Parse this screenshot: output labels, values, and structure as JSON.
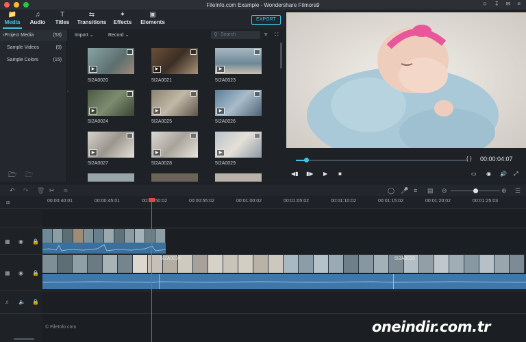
{
  "window": {
    "title": "FileInfo.com Example - Wondershare Filmora9",
    "traffic_colors": [
      "#ff5f57",
      "#febc2e",
      "#28c840"
    ],
    "titlebar_icons": [
      "user-icon",
      "download-icon",
      "mail-icon",
      "menu-icon"
    ]
  },
  "tabs": [
    {
      "label": "Media",
      "icon": "folder-icon",
      "active": true
    },
    {
      "label": "Audio",
      "icon": "music-note-icon",
      "active": false
    },
    {
      "label": "Titles",
      "icon": "text-icon",
      "active": false
    },
    {
      "label": "Transitions",
      "icon": "transitions-icon",
      "active": false
    },
    {
      "label": "Effects",
      "icon": "effects-icon",
      "active": false
    },
    {
      "label": "Elements",
      "icon": "elements-icon",
      "active": false
    }
  ],
  "export_label": "EXPORT",
  "accent_color": "#3fc5e6",
  "sidebar": {
    "items": [
      {
        "label": "Project Media",
        "count": "(53)",
        "prefix": "›"
      },
      {
        "label": "Sample Videos",
        "count": "(9)",
        "prefix": ""
      },
      {
        "label": "Sample Colors",
        "count": "(15)",
        "prefix": ""
      }
    ]
  },
  "media_toolbar": {
    "import_label": "Import",
    "record_label": "Record",
    "search_placeholder": "Search"
  },
  "media_items": [
    {
      "name": "5I2A0020"
    },
    {
      "name": "5I2A0021"
    },
    {
      "name": "5I2A0023"
    },
    {
      "name": "5I2A0024"
    },
    {
      "name": "5I2A0025"
    },
    {
      "name": "5I2A0026"
    },
    {
      "name": "5I2A0027"
    },
    {
      "name": "5I2A0028"
    },
    {
      "name": "5I2A0029"
    }
  ],
  "preview": {
    "timecode": "00:00:04:07",
    "braces": "{ }",
    "progress_fraction": 0.06
  },
  "ruler_labels": [
    "00:00:40:01",
    "00:00:45:01",
    "00:00:50:02",
    "00:00:55:02",
    "00:01:00:02",
    "00:01:05:02",
    "00:01:10:02",
    "00:01:15:02",
    "00:01:20:02",
    "00:01:25:03"
  ],
  "timeline": {
    "clip_labels": [
      "5I2A0034",
      "5I2A0035"
    ],
    "zoom_fraction": 0.5
  },
  "watermarks": {
    "left": "© FileInfo.com",
    "right": "oneindir.com.tr"
  }
}
